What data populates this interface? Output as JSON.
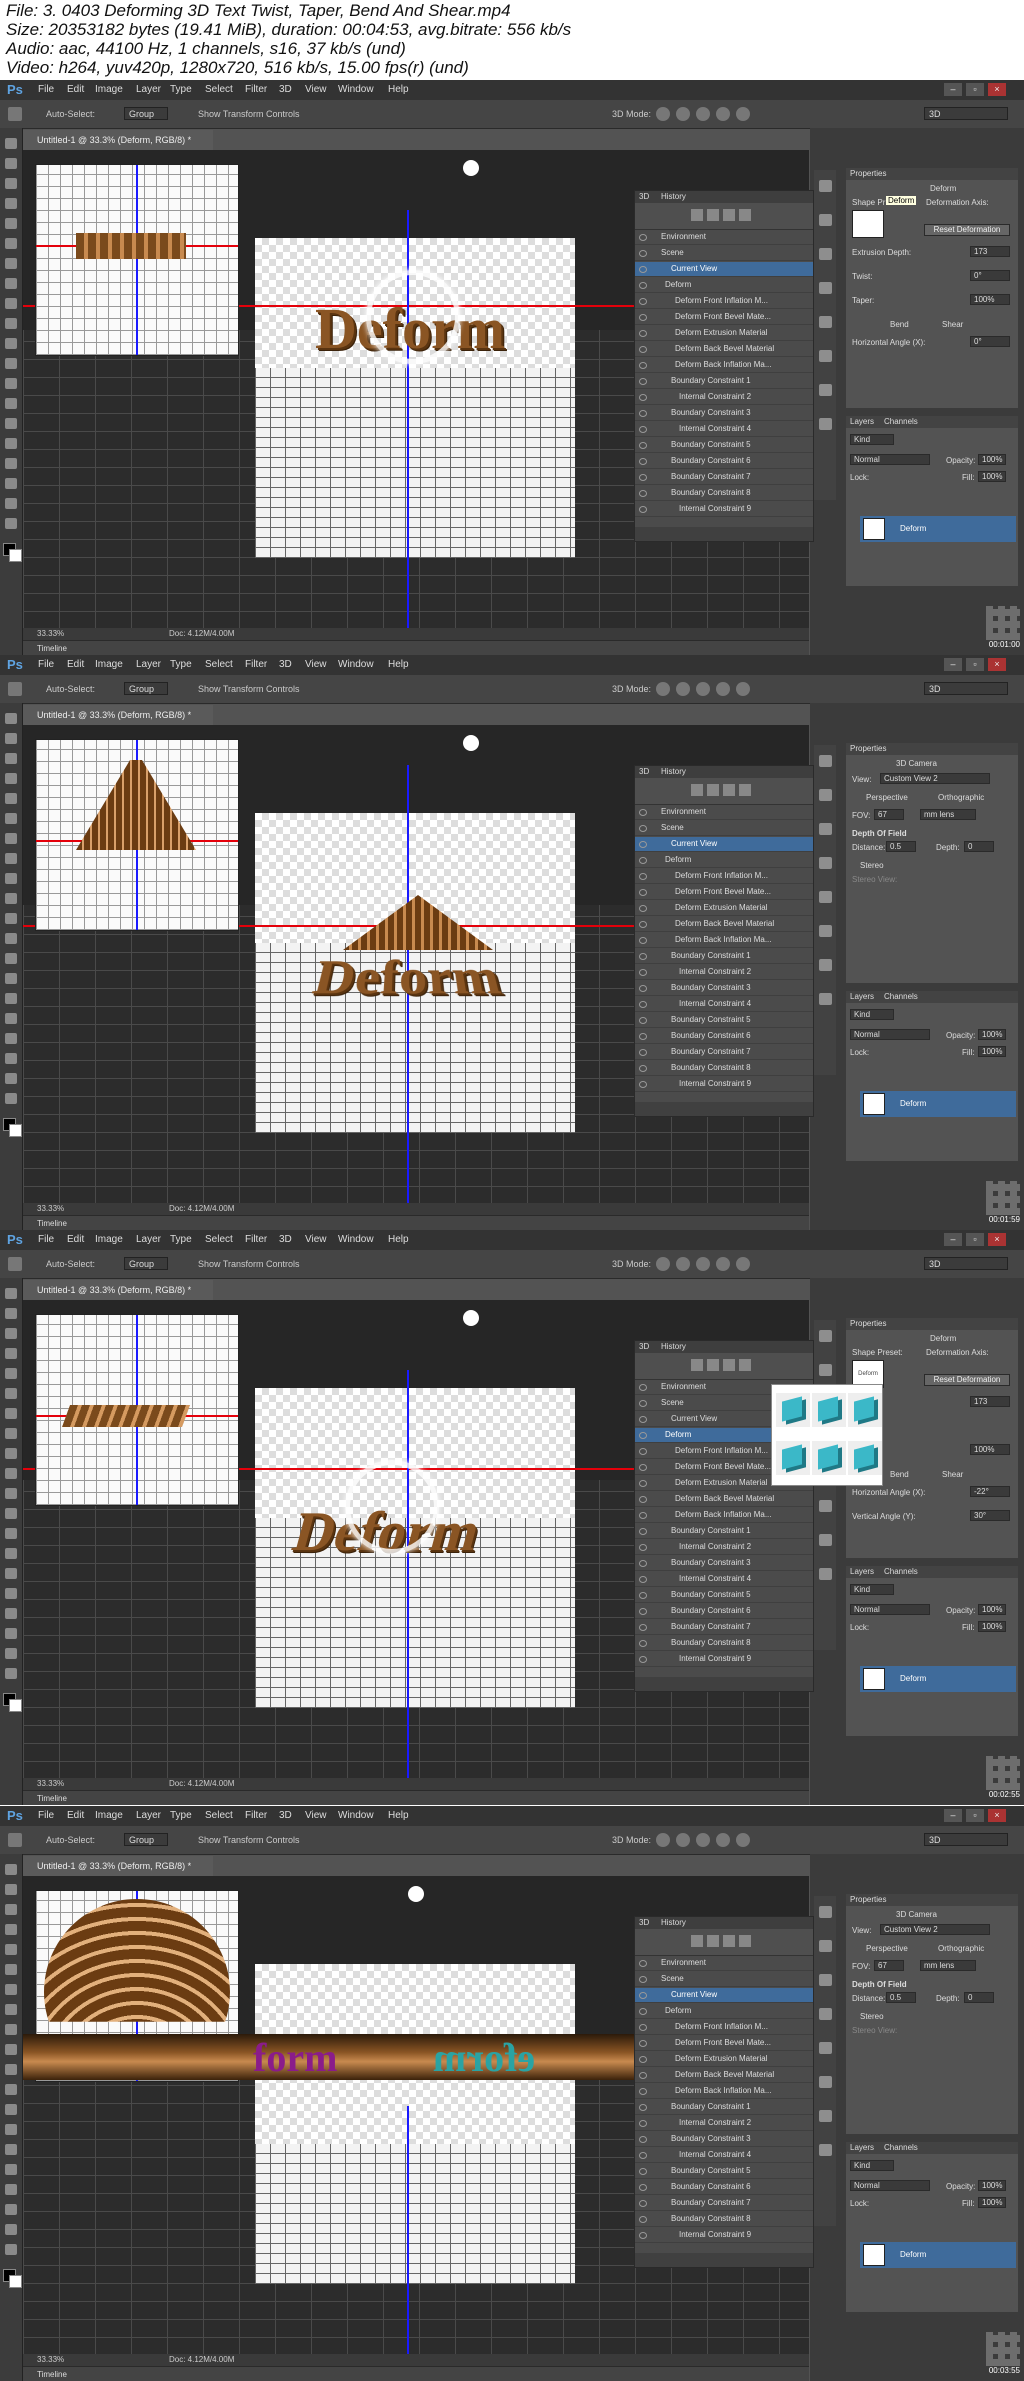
{
  "header": {
    "line1": "File: 3. 0403 Deforming 3D Text Twist, Taper, Bend And Shear.mp4",
    "line2": "Size: 20353182 bytes (19.41 MiB), duration: 00:04:53, avg.bitrate: 556 kb/s",
    "line3": "Audio: aac, 44100 Hz, 1 channels, s16, 37 kb/s (und)",
    "line4": "Video: h264, yuv420p, 1280x720, 516 kb/s, 15.00 fps(r) (und)"
  },
  "menu": {
    "ps": "Ps",
    "items": [
      "File",
      "Edit",
      "Image",
      "Layer",
      "Type",
      "Select",
      "Filter",
      "3D",
      "View",
      "Window",
      "Help"
    ]
  },
  "options": {
    "autoselect": "Auto-Select:",
    "group": "Group",
    "transform": "Show Transform Controls",
    "mode": "3D Mode:",
    "workspace": "3D"
  },
  "document": {
    "tab": "Untitled-1 @ 33.3% (Deform, RGB/8) *",
    "zoom": "33.33%",
    "doc": "Doc: 4.12M/4.00M",
    "timeline": "Timeline"
  },
  "history": {
    "tab_3d": "3D",
    "tab_history": "History",
    "items": [
      "Environment",
      "Scene",
      "Current View",
      "Deform",
      "Deform Front Inflation M...",
      "Deform Front Bevel Mate...",
      "Deform Extrusion Material",
      "Deform Back Bevel Material",
      "Deform Back Inflation Ma...",
      "Boundary Constraint 1",
      "Internal Constraint 2",
      "Boundary Constraint 3",
      "Internal Constraint 4",
      "Boundary Constraint 5",
      "Boundary Constraint 6",
      "Boundary Constraint 7",
      "Boundary Constraint 8",
      "Internal Constraint 9"
    ]
  },
  "properties_deform": {
    "header": "Properties",
    "title": "Deform",
    "shape_preset": "Shape Pr",
    "tooltip": "Deform",
    "deformation_axis": "Deformation Axis:",
    "reset": "Reset Deformation",
    "extrusion_depth": "Extrusion Depth:",
    "extrusion_value": "173",
    "twist": "Twist:",
    "twist_value": "0°",
    "taper": "Taper:",
    "taper_value": "100%",
    "bend": "Bend",
    "shear": "Shear",
    "horizontal": "Horizontal Angle (X):",
    "horizontal_value": "0°"
  },
  "properties_deform3": {
    "shape_preset": "Shape Preset:",
    "horizontal_value": "-22°",
    "vertical": "Vertical Angle (Y):",
    "vertical_value": "30°",
    "preview": "Deform"
  },
  "properties_camera": {
    "header": "Properties",
    "title": "3D Camera",
    "view_label": "View:",
    "view_value": "Custom View 2",
    "perspective": "Perspective",
    "orthographic": "Orthographic",
    "fov_label": "FOV:",
    "fov_value": "67",
    "lens": "mm lens",
    "dof": "Depth Of Field",
    "distance": "Distance:",
    "distance_value": "0.5",
    "depth": "Depth:",
    "depth_value": "0",
    "stereo": "Stereo",
    "stereo_view": "Stereo View:"
  },
  "layers": {
    "tab_layers": "Layers",
    "tab_channels": "Channels",
    "kind": "Kind",
    "normal": "Normal",
    "opacity": "Opacity:",
    "opacity_value": "100%",
    "lock": "Lock:",
    "fill": "Fill:",
    "fill_value": "100%",
    "layer_name": "Deform"
  },
  "canvas_text": {
    "word": "Deform",
    "left": "form",
    "right": "eform"
  },
  "timestamps": [
    "00:01:00",
    "00:01:59",
    "00:02:55",
    "00:03:55"
  ]
}
